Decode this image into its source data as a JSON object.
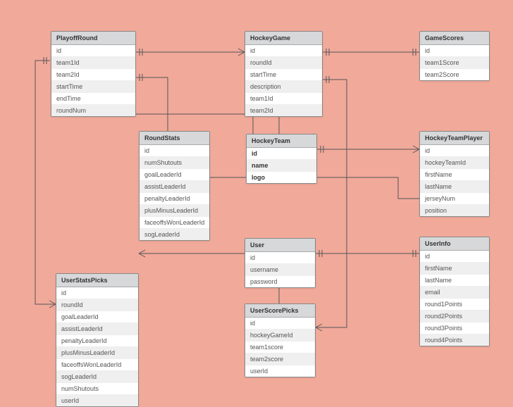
{
  "entities": {
    "PlayoffRound": {
      "title": "PlayoffRound",
      "attrs": [
        "id",
        "team1Id",
        "team2Id",
        "startTime",
        "endTime",
        "roundNum"
      ]
    },
    "HockeyGame": {
      "title": "HockeyGame",
      "attrs": [
        "id",
        "roundId",
        "startTime",
        "description",
        "team1Id",
        "team2Id"
      ]
    },
    "GameScores": {
      "title": "GameScores",
      "attrs": [
        "id",
        "team1Score",
        "team2Score"
      ]
    },
    "RoundStats": {
      "title": "RoundStats",
      "attrs": [
        "id",
        "numShutouts",
        "goalLeaderId",
        "assistLeaderId",
        "penaltyLeaderId",
        "plusMinusLeaderId",
        "faceoffsWonLeaderId",
        "sogLeaderId"
      ]
    },
    "HockeyTeam": {
      "title": "HockeyTeam",
      "attrs": [
        "id",
        "name",
        "logo"
      ],
      "bold": true
    },
    "HockeyTeamPlayer": {
      "title": "HockeyTeamPlayer",
      "attrs": [
        "id",
        "hockeyTeamId",
        "firstName",
        "lastName",
        "jerseyNum",
        "position"
      ]
    },
    "User": {
      "title": "User",
      "attrs": [
        "id",
        "username",
        "password"
      ]
    },
    "UserInfo": {
      "title": "UserInfo",
      "attrs": [
        "id",
        "firstName",
        "lastName",
        "email",
        "round1Points",
        "round2Points",
        "round3Points",
        "round4Points"
      ]
    },
    "UserStatsPicks": {
      "title": "UserStatsPicks",
      "attrs": [
        "id",
        "roundId",
        "goalLeaderId",
        "assistLeaderId",
        "penaltyLeaderId",
        "plusMinusLeaderId",
        "faceoffsWonLeaderId",
        "sogLeaderId",
        "numShutouts",
        "userId"
      ]
    },
    "UserScorePicks": {
      "title": "UserScorePicks",
      "attrs": [
        "id",
        "hockeyGameId",
        "team1score",
        "team2score",
        "userId"
      ]
    }
  }
}
